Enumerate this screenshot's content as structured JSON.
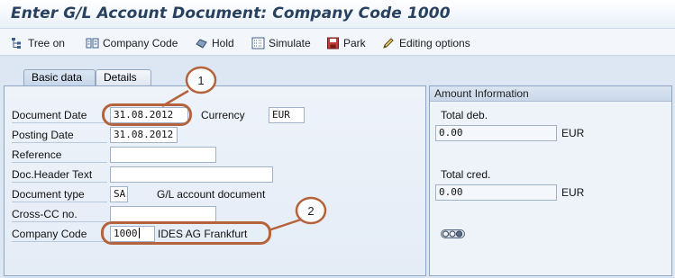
{
  "window": {
    "title": "Enter G/L Account Document: Company Code 1000"
  },
  "toolbar": {
    "items": [
      {
        "label": "Tree on",
        "icon": "tree-icon"
      },
      {
        "label": "Company Code",
        "icon": "company-code-icon"
      },
      {
        "label": "Hold",
        "icon": "hold-icon"
      },
      {
        "label": "Simulate",
        "icon": "simulate-icon"
      },
      {
        "label": "Park",
        "icon": "park-icon"
      },
      {
        "label": "Editing options",
        "icon": "pencil-icon"
      }
    ]
  },
  "tabs": [
    {
      "label": "Basic data",
      "active": true
    },
    {
      "label": "Details",
      "active": false
    }
  ],
  "form": {
    "document_date": {
      "label": "Document Date",
      "value": "31.08.2012"
    },
    "currency": {
      "label": "Currency",
      "value": "EUR"
    },
    "posting_date": {
      "label": "Posting Date",
      "value": "31.08.2012"
    },
    "reference": {
      "label": "Reference",
      "value": ""
    },
    "doc_header_text": {
      "label": "Doc.Header Text",
      "value": ""
    },
    "document_type": {
      "label": "Document type",
      "value": "SA",
      "description": "G/L account document"
    },
    "cross_cc_no": {
      "label": "Cross-CC no.",
      "value": ""
    },
    "company_code": {
      "label": "Company Code",
      "value": "1000",
      "description": "IDES AG Frankfurt"
    }
  },
  "amount_info": {
    "header": "Amount Information",
    "total_deb_label": "Total deb.",
    "total_deb_value": "0.00",
    "total_deb_currency": "EUR",
    "total_cred_label": "Total cred.",
    "total_cred_value": "0.00",
    "total_cred_currency": "EUR",
    "status_icon": "traffic-light-icon"
  },
  "callouts": [
    {
      "number": "1"
    },
    {
      "number": "2"
    }
  ],
  "colors": {
    "title": "#27415f",
    "callout": "#b4633c",
    "panel_border": "#8fa6c2"
  }
}
